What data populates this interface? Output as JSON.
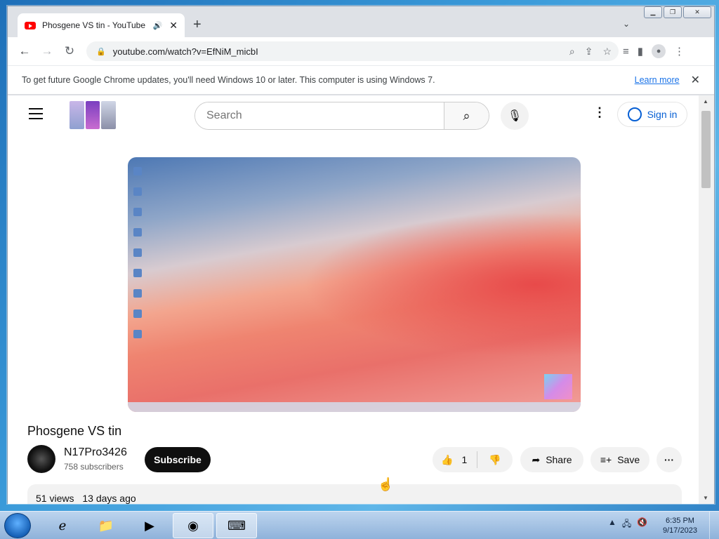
{
  "browser": {
    "tab_title": "Phosgene VS tin - YouTube",
    "url": "youtube.com/watch?v=EfNiM_micbI",
    "infobar_message": "To get future Google Chrome updates, you'll need Windows 10 or later. This computer is using Windows 7.",
    "infobar_link": "Learn more"
  },
  "youtube": {
    "search_placeholder": "Search",
    "signin_label": "Sign in",
    "video_title": "Phosgene VS tin",
    "channel_name": "N17Pro3426",
    "subscribers": "758 subscribers",
    "subscribe_label": "Subscribe",
    "like_count": "1",
    "share_label": "Share",
    "save_label": "Save",
    "views": "51 views",
    "age": "13 days ago"
  },
  "taskbar": {
    "time": "6:35 PM",
    "date": "9/17/2023"
  },
  "colors": {
    "accent_blue": "#065fd4",
    "yt_red": "#ff0000",
    "subscribe_bg": "#0f0f0f"
  }
}
